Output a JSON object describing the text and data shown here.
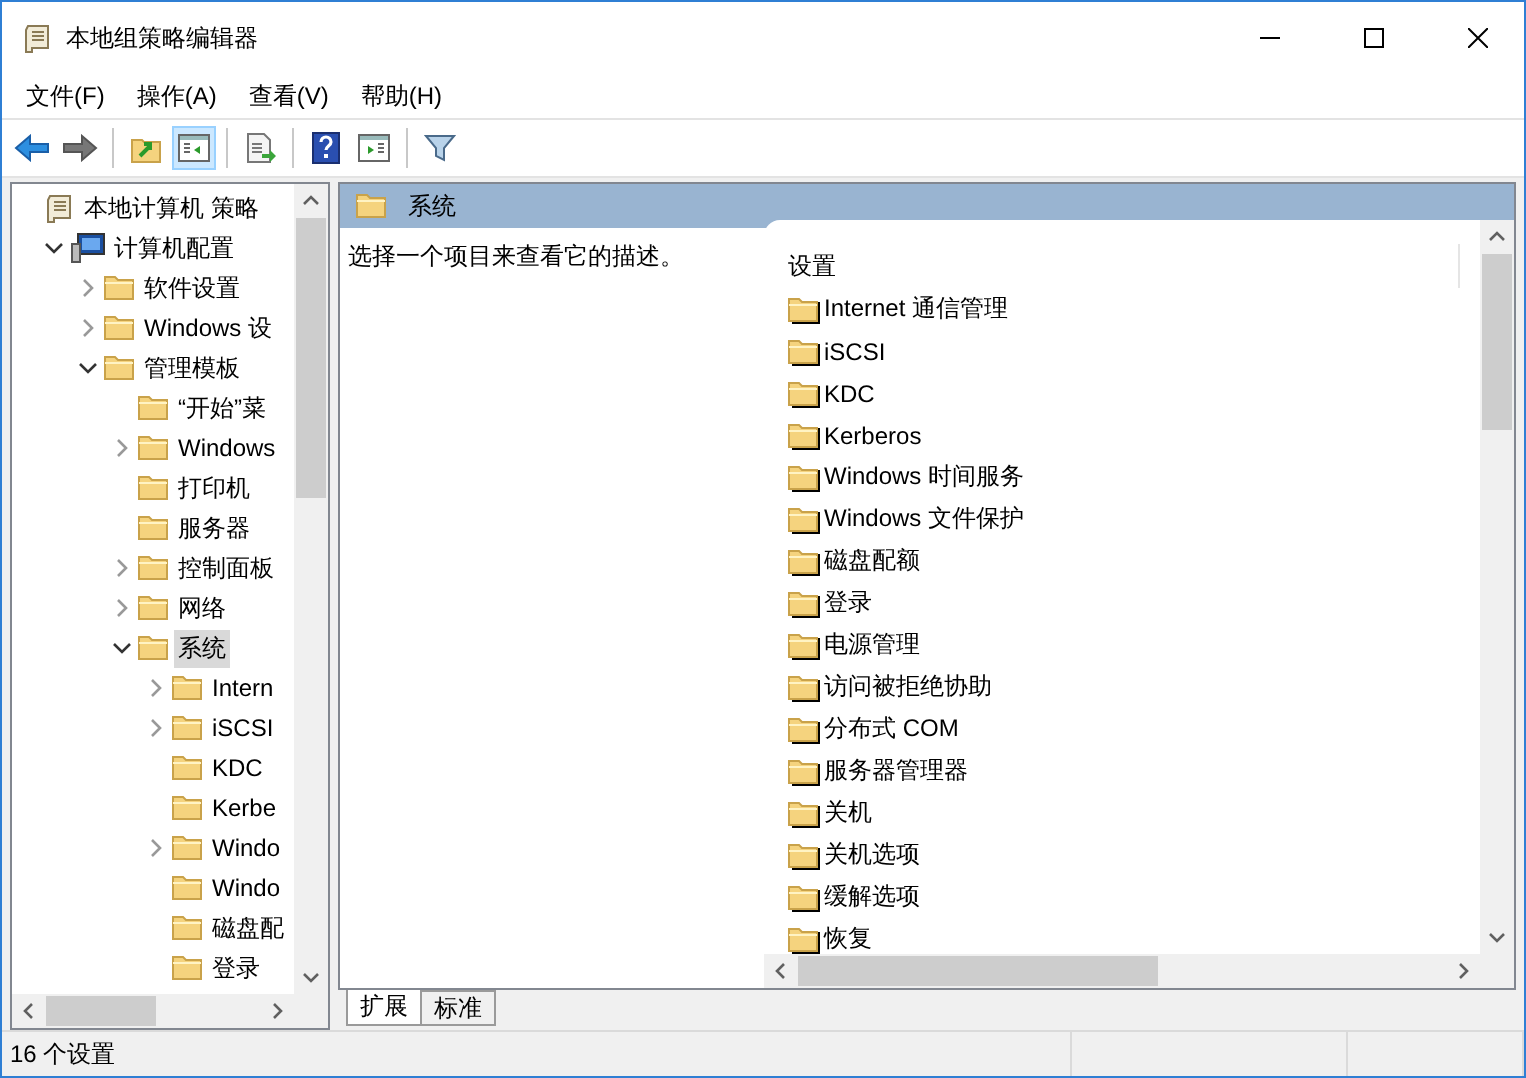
{
  "window": {
    "title": "本地组策略编辑器"
  },
  "menu": [
    "文件(F)",
    "操作(A)",
    "查看(V)",
    "帮助(H)"
  ],
  "toolbar": [
    {
      "kind": "back",
      "pressed": false
    },
    {
      "kind": "forward",
      "pressed": false
    },
    {
      "kind": "separator"
    },
    {
      "kind": "up",
      "pressed": false
    },
    {
      "kind": "tree-toggle",
      "pressed": true
    },
    {
      "kind": "separator"
    },
    {
      "kind": "export",
      "pressed": false
    },
    {
      "kind": "separator"
    },
    {
      "kind": "help",
      "pressed": false
    },
    {
      "kind": "pane",
      "pressed": false
    },
    {
      "kind": "separator"
    },
    {
      "kind": "filter",
      "pressed": false
    }
  ],
  "tree": {
    "items": [
      {
        "label": "本地计算机 策略",
        "kind": "policy",
        "selected": false,
        "children": [
          {
            "label": "计算机配置",
            "kind": "computer",
            "expanded": true,
            "selected": false,
            "children": [
              {
                "label": "软件设置",
                "kind": "folder",
                "expanded": false,
                "selected": false
              },
              {
                "label": "Windows 设",
                "kind": "folder",
                "expanded": false,
                "selected": false
              },
              {
                "label": "管理模板",
                "kind": "folder",
                "expanded": true,
                "selected": false,
                "children": [
                  {
                    "label": "“开始”菜",
                    "kind": "folder",
                    "selected": false
                  },
                  {
                    "label": "Windows",
                    "kind": "folder",
                    "expanded": false,
                    "selected": false
                  },
                  {
                    "label": "打印机",
                    "kind": "folder",
                    "selected": false
                  },
                  {
                    "label": "服务器",
                    "kind": "folder",
                    "selected": false
                  },
                  {
                    "label": "控制面板",
                    "kind": "folder",
                    "expanded": false,
                    "selected": false
                  },
                  {
                    "label": "网络",
                    "kind": "folder",
                    "expanded": false,
                    "selected": false
                  },
                  {
                    "label": "系统",
                    "kind": "folder",
                    "expanded": true,
                    "selected": true,
                    "children": [
                      {
                        "label": "Intern",
                        "kind": "folder",
                        "expanded": false,
                        "selected": false
                      },
                      {
                        "label": "iSCSI",
                        "kind": "folder",
                        "expanded": false,
                        "selected": false
                      },
                      {
                        "label": "KDC",
                        "kind": "folder",
                        "selected": false
                      },
                      {
                        "label": "Kerbe",
                        "kind": "folder",
                        "selected": false
                      },
                      {
                        "label": "Windo",
                        "kind": "folder",
                        "expanded": false,
                        "selected": false
                      },
                      {
                        "label": "Windo",
                        "kind": "folder",
                        "selected": false
                      },
                      {
                        "label": "磁盘配",
                        "kind": "folder",
                        "selected": false
                      },
                      {
                        "label": "登录",
                        "kind": "folder",
                        "selected": false
                      }
                    ]
                  }
                ]
              }
            ]
          }
        ]
      }
    ]
  },
  "details": {
    "header": "系统",
    "description": "选择一个项目来查看它的描述。",
    "column": "设置",
    "items": [
      "Internet 通信管理",
      "iSCSI",
      "KDC",
      "Kerberos",
      "Windows 时间服务",
      "Windows 文件保护",
      "磁盘配额",
      "登录",
      "电源管理",
      "访问被拒绝协助",
      "分布式 COM",
      "服务器管理器",
      "关机",
      "关机选项",
      "缓解选项",
      "恢复"
    ]
  },
  "tabs": [
    {
      "label": "扩展",
      "selected": true
    },
    {
      "label": "标准",
      "selected": false
    }
  ],
  "status_bar": {
    "text": "16 个设置"
  }
}
